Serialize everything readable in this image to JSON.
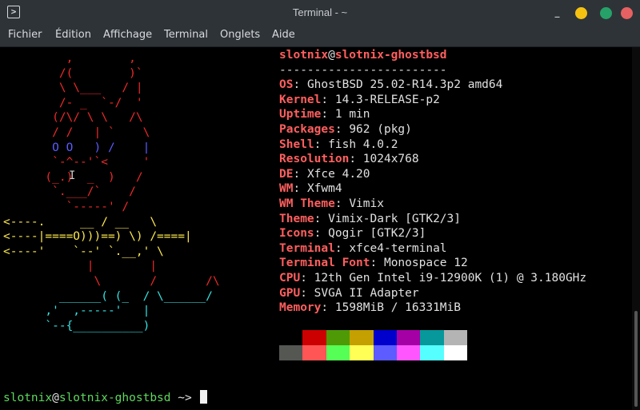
{
  "window": {
    "title": "Terminal - ~",
    "icon": "terminal-app-icon",
    "controls": {
      "minimize": "_",
      "colors": [
        "#f5c211",
        "#26a269",
        "#e66161"
      ]
    }
  },
  "menu": [
    "Fichier",
    "Édition",
    "Affichage",
    "Terminal",
    "Onglets",
    "Aide"
  ],
  "fastfetch": {
    "ascii_art": [
      [
        "(r)",
        "         ,        ,"
      ],
      [
        "(r)",
        "        /(        )`"
      ],
      [
        "(r)",
        "        \\ \\___   / |"
      ],
      [
        "(r)",
        "        /- _  `-/  '"
      ],
      [
        "(r)",
        "       (/\\/ \\ \\   /\\"
      ],
      [
        "(r)",
        "       / /   | `    \\"
      ],
      [
        "(b)",
        "       O O   ) /    |"
      ],
      [
        "(r)",
        "       `-^--'`<     '"
      ],
      [
        "(r)",
        "      (_.)  _  )   /"
      ],
      [
        "(r)",
        "       `.___/`    /"
      ],
      [
        "(r)",
        "         `-----' /"
      ],
      [
        "(y)",
        "<----.     __ / __   \\"
      ],
      [
        "(y)",
        "<----|====O)))==) \\) /====|"
      ],
      [
        "(y)",
        "<----'    `--' `.__,' \\"
      ],
      [
        "(r)",
        "            |        |"
      ],
      [
        "(r)",
        "             \\       /       /\\"
      ],
      [
        "(c)",
        "        ______( (_  / \\______/"
      ],
      [
        "(c)",
        "      ,'  ,-----'   |"
      ],
      [
        "(c)",
        "      `--{__________)"
      ]
    ],
    "user": "slotnix",
    "at": "@",
    "host": "slotnix-ghostbsd",
    "separator": "------------------------",
    "info": [
      {
        "key": "OS",
        "value": "GhostBSD 25.02-R14.3p2 amd64"
      },
      {
        "key": "Kernel",
        "value": "14.3-RELEASE-p2"
      },
      {
        "key": "Uptime",
        "value": "1 min"
      },
      {
        "key": "Packages",
        "value": "962 (pkg)"
      },
      {
        "key": "Shell",
        "value": "fish 4.0.2"
      },
      {
        "key": "Resolution",
        "value": "1024x768"
      },
      {
        "key": "DE",
        "value": "Xfce 4.20"
      },
      {
        "key": "WM",
        "value": "Xfwm4"
      },
      {
        "key": "WM Theme",
        "value": "Vimix"
      },
      {
        "key": "Theme",
        "value": "Vimix-Dark [GTK2/3]"
      },
      {
        "key": "Icons",
        "value": "Qogir [GTK2/3]"
      },
      {
        "key": "Terminal",
        "value": "xfce4-terminal"
      },
      {
        "key": "Terminal Font",
        "value": "Monospace 12"
      },
      {
        "key": "CPU",
        "value": "12th Gen Intel i9-12900K (1) @ 3.180GHz"
      },
      {
        "key": "GPU",
        "value": "SVGA II Adapter"
      },
      {
        "key": "Memory",
        "value": "1598MiB / 16331MiB"
      }
    ],
    "palette_normal": [
      "#000000",
      "#cc0000",
      "#4e9a06",
      "#c4a000",
      "#0000cc",
      "#a500a5",
      "#06989a",
      "#b4b4b4"
    ],
    "palette_bright": [
      "#555753",
      "#ff5555",
      "#55ff55",
      "#ffff55",
      "#5c5cff",
      "#ff55ff",
      "#55ffff",
      "#ffffff"
    ]
  },
  "prompt": {
    "user": "slotnix",
    "at": "@",
    "host": "slotnix-ghostbsd",
    "cwd": "~>"
  },
  "colors": {
    "key": "#ff5f5f",
    "value": "#e0e0e0",
    "prompt_user": "#5fd75f"
  }
}
